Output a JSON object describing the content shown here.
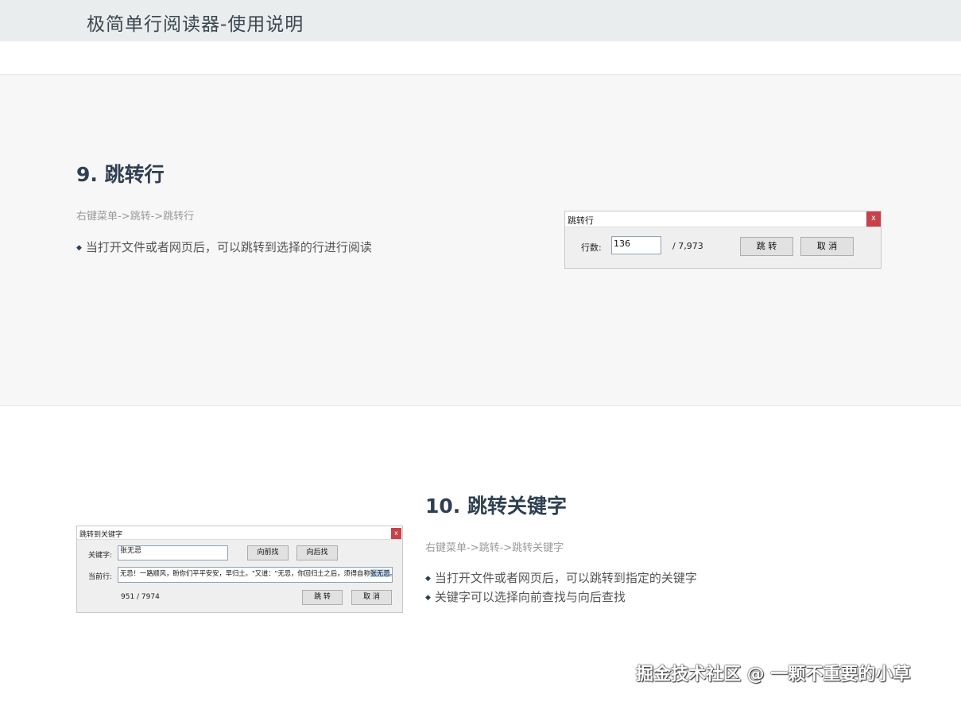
{
  "header": {
    "title": "极简单行阅读器-使用说明"
  },
  "section9": {
    "heading": "9. 跳转行",
    "path": "右键菜单->跳转->跳转行",
    "bullets": [
      "当打开文件或者网页后，可以跳转到选择的行进行阅读"
    ],
    "dialog": {
      "title": "跳转行",
      "close": "x",
      "line_label": "行数:",
      "line_value": "136",
      "total": "/ 7,973",
      "jump_button": "跳 转",
      "cancel_button": "取 消"
    }
  },
  "section10": {
    "heading": "10. 跳转关键字",
    "path": "右键菜单->跳转->跳转关键字",
    "bullets": [
      "当打开文件或者网页后，可以跳转到指定的关键字",
      "关键字可以选择向前查找与向后查找"
    ],
    "dialog": {
      "title": "跳转到关键字",
      "close": "x",
      "keyword_label": "关键字:",
      "keyword_value": "张无忌",
      "prev_button": "向前找",
      "next_button": "向后找",
      "current_label": "当前行:",
      "current_text": "无忌！一路顺风，盼你们平平安安，早归土。\"又道：\"无忌，你回归土之后，须得自称",
      "current_highlight": "张无忌",
      "current_tail": "。",
      "position": "951 / 7974",
      "jump_button": "跳 转",
      "cancel_button": "取 消"
    }
  },
  "watermark": "掘金技术社区 @ 一颗不重要的小草"
}
